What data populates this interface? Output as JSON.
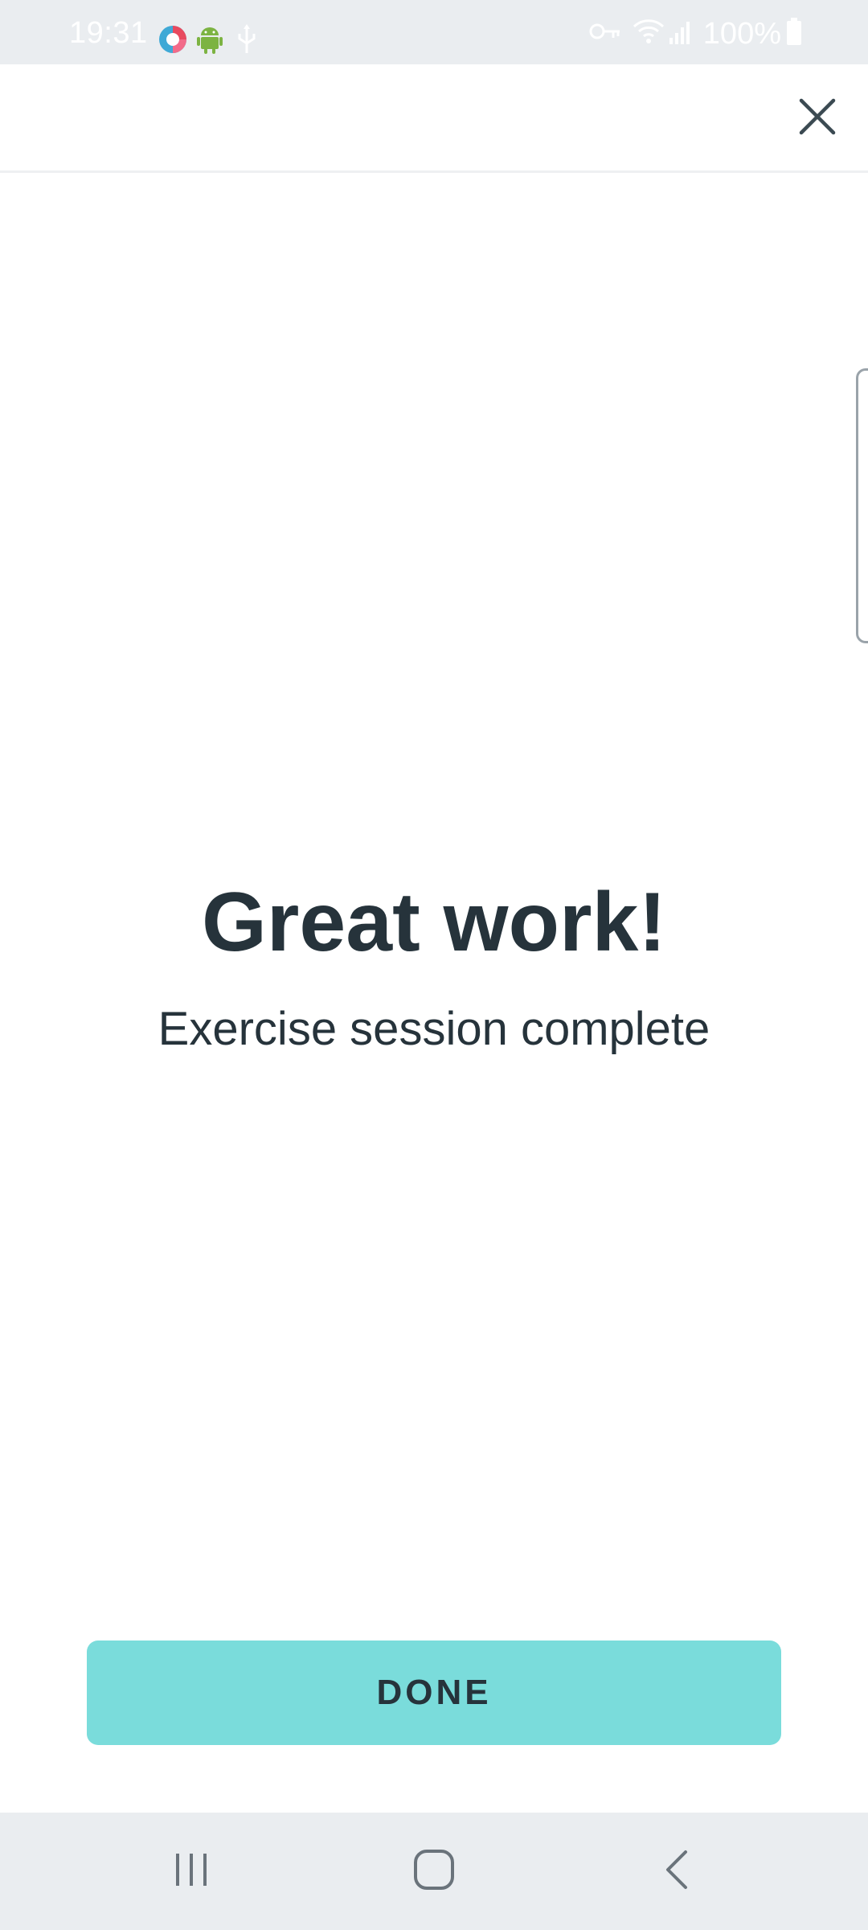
{
  "status_bar": {
    "time": "19:31",
    "battery": "100%",
    "icons": [
      "app-notification-icon",
      "android-icon",
      "usb-icon",
      "vpn-key-icon",
      "wifi-icon",
      "signal-icon",
      "battery-icon"
    ]
  },
  "header": {
    "close_icon": "close-icon"
  },
  "main": {
    "headline": "Great work!",
    "subtitle": "Exercise session complete"
  },
  "actions": {
    "done_label": "DONE"
  },
  "colors": {
    "accent": "#7adcdb",
    "text": "#26333b",
    "status_bar_bg": "#eaedf0"
  },
  "nav_bar": {
    "icons": [
      "recent-apps-icon",
      "home-icon",
      "back-icon"
    ]
  }
}
